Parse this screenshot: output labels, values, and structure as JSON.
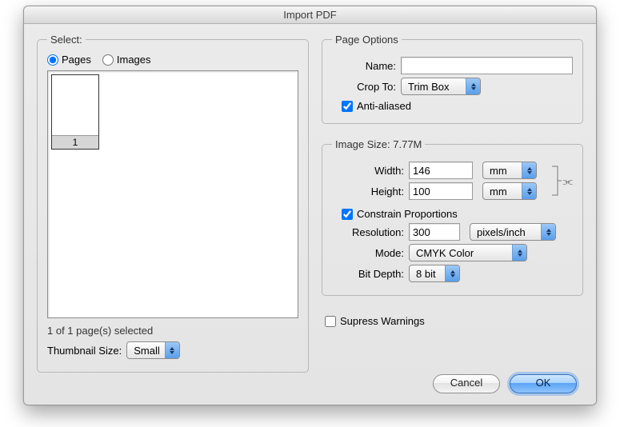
{
  "title": "Import PDF",
  "select": {
    "legend": "Select:",
    "radio_pages": "Pages",
    "radio_images": "Images",
    "selected_radio": "pages",
    "thumb_label": "1",
    "status": "1 of 1 page(s) selected",
    "thumb_size_label": "Thumbnail Size:",
    "thumb_size_value": "Small"
  },
  "page_options": {
    "legend": "Page Options",
    "name_label": "Name:",
    "name_value": "",
    "crop_label": "Crop To:",
    "crop_value": "Trim Box",
    "antialias_label": "Anti-aliased",
    "antialias_checked": true
  },
  "image_size": {
    "legend": "Image Size: 7.77M",
    "width_label": "Width:",
    "width_value": "146",
    "width_unit": "mm",
    "height_label": "Height:",
    "height_value": "100",
    "height_unit": "mm",
    "constrain_label": "Constrain Proportions",
    "constrain_checked": true,
    "resolution_label": "Resolution:",
    "resolution_value": "300",
    "resolution_unit": "pixels/inch",
    "mode_label": "Mode:",
    "mode_value": "CMYK Color",
    "bitdepth_label": "Bit Depth:",
    "bitdepth_value": "8 bit"
  },
  "suppress": {
    "label": "Supress Warnings",
    "checked": false
  },
  "buttons": {
    "cancel": "Cancel",
    "ok": "OK"
  }
}
